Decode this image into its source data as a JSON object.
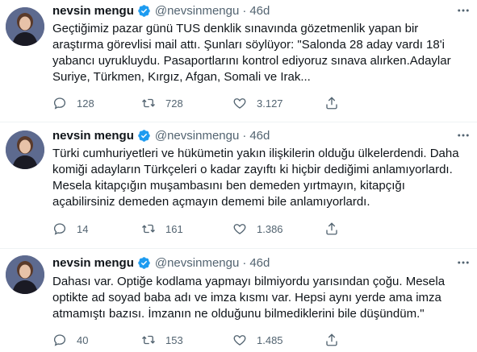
{
  "tweets": [
    {
      "name": "nevsin mengu",
      "handle": "@nevsinmengu",
      "separator": "·",
      "time": "46d",
      "lines": [
        "Geçtiğimiz pazar günü TUS denklik sınavında gözetmenlik yapan bir",
        "araştırma görevlisi mail attı. Şunları söylüyor: \"Salonda 28 aday vardı 18'i",
        "yabancı uyrukluydu. Pasaportlarını kontrol ediyoruz sınava alırken.Adaylar",
        "Suriye, Türkmen, Kırgız, Afgan, Somali ve Irak..."
      ],
      "replies": "128",
      "retweets": "728",
      "likes": "3.127"
    },
    {
      "name": "nevsin mengu",
      "handle": "@nevsinmengu",
      "separator": "·",
      "time": "46d",
      "lines": [
        "Türki cumhuriyetleri ve hükümetin yakın ilişkilerin olduğu ülkelerdendi. Daha",
        "komiği adayların Türkçeleri o kadar zayıftı ki hiçbir dediğimi anlamıyorlardı.",
        "Mesela kitapçığın muşambasını ben demeden yırtmayın, kitapçığı",
        "açabilirsiniz demeden açmayın dememi bile anlamıyorlardı."
      ],
      "replies": "14",
      "retweets": "161",
      "likes": "1.386"
    },
    {
      "name": "nevsin mengu",
      "handle": "@nevsinmengu",
      "separator": "·",
      "time": "46d",
      "lines": [
        "Dahası var. Optiğe kodlama yapmayı bilmiyordu yarısından çoğu. Mesela",
        "optikte ad soyad baba adı ve imza kısmı var. Hepsi aynı yerde ama imza",
        "atmamıştı bazısı. İmzanın ne olduğunu bilmediklerini bile düşündüm.\""
      ],
      "replies": "40",
      "retweets": "153",
      "likes": "1.485"
    }
  ],
  "colors": {
    "text": "#0f1419",
    "secondary": "#536471",
    "verified": "#1d9bf0",
    "divider": "#eff3f4"
  },
  "icons": {
    "verified": "verified-badge-icon",
    "reply": "reply-icon",
    "retweet": "retweet-icon",
    "like": "heart-icon",
    "share": "share-icon",
    "more": "more-icon"
  }
}
